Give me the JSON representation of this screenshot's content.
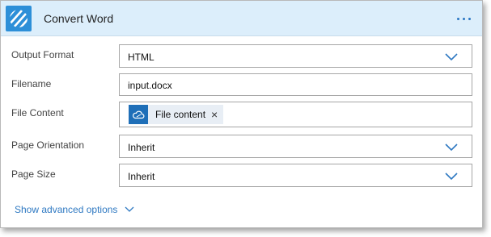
{
  "action": {
    "title": "Convert Word",
    "more_icon": "ellipsis-icon",
    "logo_icon": "striped-logo-icon"
  },
  "fields": {
    "output_format": {
      "label": "Output Format",
      "value": "HTML"
    },
    "filename": {
      "label": "Filename",
      "value": "input.docx"
    },
    "file_content": {
      "label": "File Content",
      "token_label": "File content",
      "token_icon": "onedrive-cloud-icon",
      "remove_glyph": "×"
    },
    "page_orientation": {
      "label": "Page Orientation",
      "value": "Inherit"
    },
    "page_size": {
      "label": "Page Size",
      "value": "Inherit"
    }
  },
  "advanced": {
    "label": "Show advanced options"
  },
  "colors": {
    "header_bg": "#dceefb",
    "accent": "#2f79c2",
    "logo_bg": "#2d8fd8",
    "token_icon_bg": "#1f6fb8"
  }
}
